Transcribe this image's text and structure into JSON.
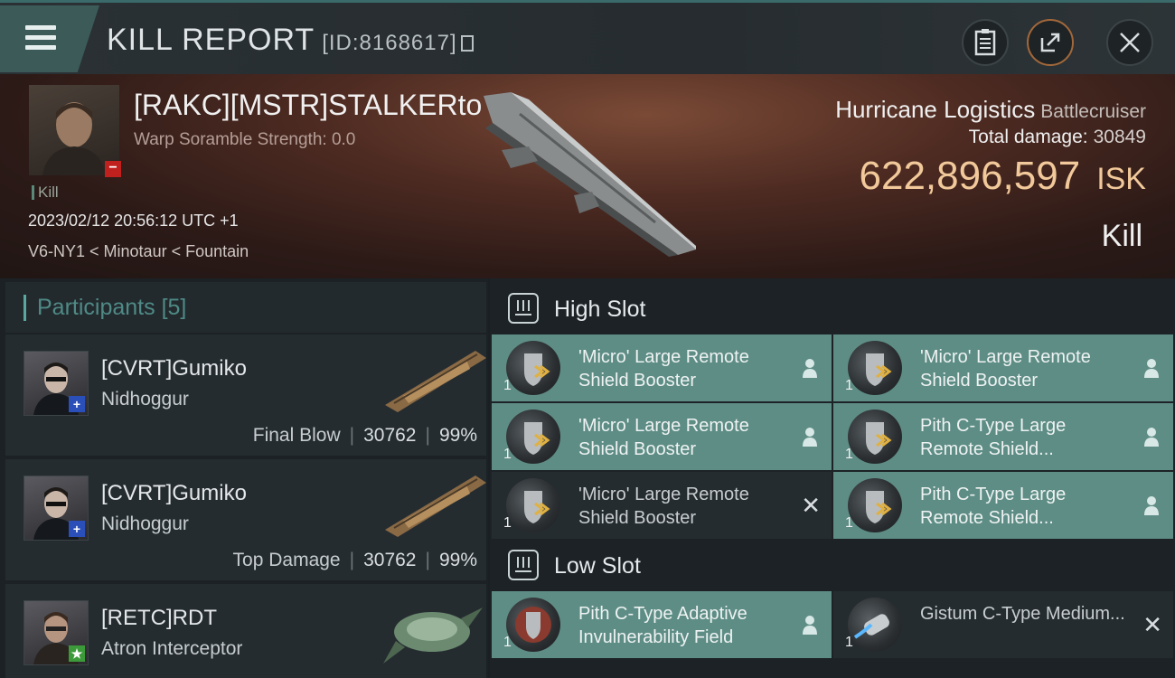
{
  "header": {
    "title": "KILL REPORT",
    "id_label": "[ID:8168617]"
  },
  "victim": {
    "pilot_name": "[RAKC][MSTR]STALKERto",
    "scramble": "Warp Soramble Strength: 0.0",
    "kill_tag": "Kill",
    "datetime": "2023/02/12 20:56:12 UTC +1",
    "location": "V6-NY1 < Minotaur < Fountain",
    "ship_name": "Hurricane Logistics",
    "ship_class": "Battlecruiser",
    "total_damage_label": "Total damage:",
    "total_damage": "30849",
    "isk_value": "622,896,597",
    "isk_unit": "ISK",
    "result": "Kill"
  },
  "participants": {
    "label": "Participants",
    "count": "[5]",
    "items": [
      {
        "name": "[CVRT]Gumiko",
        "ship": "Nidhoggur",
        "tag": "Final Blow",
        "damage": "30762",
        "percent": "99%",
        "badge": "+",
        "badge_color": "#2a4fb8"
      },
      {
        "name": "[CVRT]Gumiko",
        "ship": "Nidhoggur",
        "tag": "Top Damage",
        "damage": "30762",
        "percent": "99%",
        "badge": "+",
        "badge_color": "#2a4fb8"
      },
      {
        "name": "[RETC]RDT",
        "ship": "Atron Interceptor",
        "tag": "",
        "damage": "",
        "percent": "",
        "badge": "★",
        "badge_color": "#3d9a3a"
      }
    ]
  },
  "high_slot": {
    "label": "High Slot",
    "items": [
      {
        "name": "'Micro' Large Remote Shield Booster",
        "qty": "1",
        "state": "pilot"
      },
      {
        "name": "'Micro' Large Remote Shield Booster",
        "qty": "1",
        "state": "pilot"
      },
      {
        "name": "'Micro' Large Remote Shield Booster",
        "qty": "1",
        "state": "pilot"
      },
      {
        "name": "Pith C-Type Large Remote Shield...",
        "qty": "1",
        "state": "pilot"
      },
      {
        "name": "'Micro' Large Remote Shield Booster",
        "qty": "1",
        "state": "destroyed"
      },
      {
        "name": "Pith C-Type Large Remote Shield...",
        "qty": "1",
        "state": "pilot"
      }
    ]
  },
  "low_slot": {
    "label": "Low Slot",
    "items": [
      {
        "name": "Pith C-Type Adaptive Invulnerability Field",
        "qty": "1",
        "state": "pilot"
      },
      {
        "name": "Gistum C-Type Medium...",
        "qty": "1",
        "state": "destroyed"
      }
    ]
  },
  "colors": {
    "accent_teal": "#5aa7a1",
    "isk_gold": "#f2c99a",
    "dropped_module_bg": "#5e8d86"
  }
}
